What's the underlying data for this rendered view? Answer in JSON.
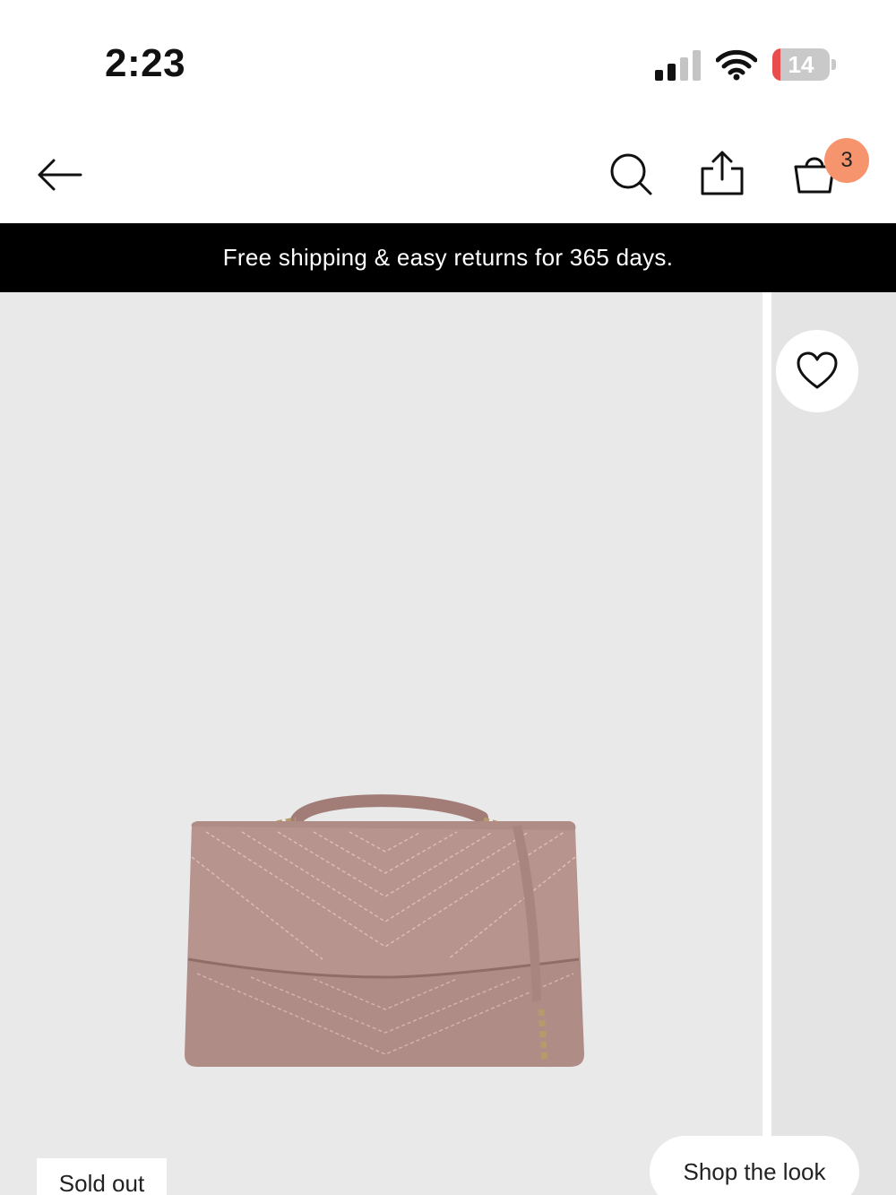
{
  "status_bar": {
    "time": "2:23",
    "battery_level": "14",
    "battery_fraction": 0.14,
    "battery_color": "#ea4d4d"
  },
  "nav": {
    "back_icon": "arrow-left-icon",
    "search_icon": "search-icon",
    "share_icon": "share-icon",
    "bag_icon": "shopping-bag-icon",
    "bag_count": "3",
    "badge_color": "#f6946d"
  },
  "promo": {
    "text": "Free shipping & easy returns for 365 days."
  },
  "product_gallery": {
    "wishlist_icon": "heart-icon",
    "image": "quilted-chevron-handbag",
    "sold_out_label": "Sold out",
    "shop_the_look_label": "Shop the look"
  }
}
